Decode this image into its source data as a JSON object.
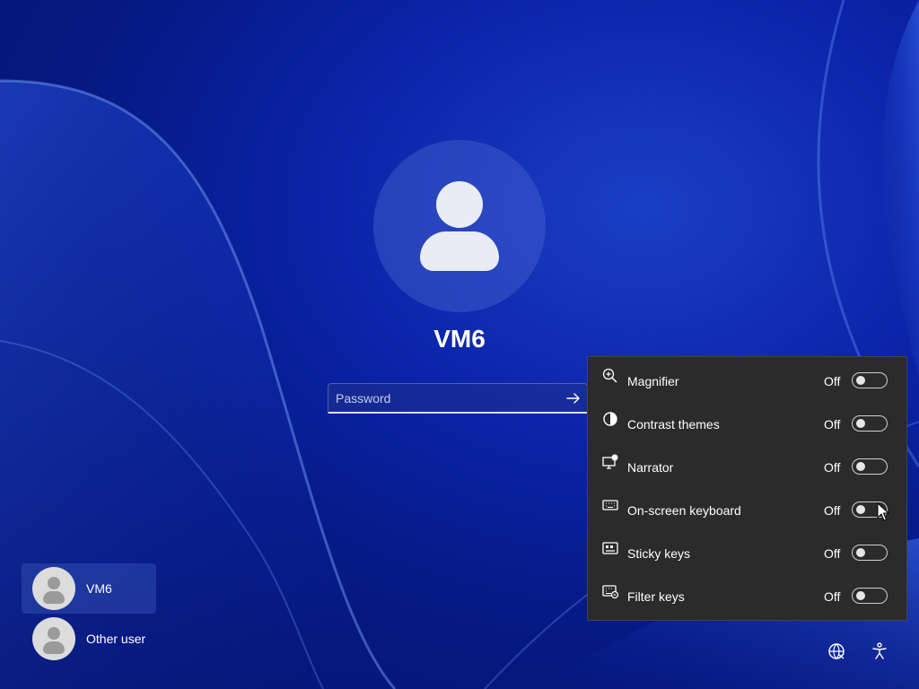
{
  "lock_screen": {
    "username": "VM6",
    "password_placeholder": "Password"
  },
  "user_list": [
    {
      "name": "VM6",
      "active": true
    },
    {
      "name": "Other user",
      "active": false
    }
  ],
  "accessibility_panel": {
    "items": [
      {
        "label": "Magnifier",
        "state": "Off",
        "icon": "magnifier-icon"
      },
      {
        "label": "Contrast themes",
        "state": "Off",
        "icon": "contrast-icon"
      },
      {
        "label": "Narrator",
        "state": "Off",
        "icon": "narrator-icon"
      },
      {
        "label": "On-screen keyboard",
        "state": "Off",
        "icon": "keyboard-icon"
      },
      {
        "label": "Sticky keys",
        "state": "Off",
        "icon": "sticky-keys-icon"
      },
      {
        "label": "Filter keys",
        "state": "Off",
        "icon": "filter-keys-icon"
      }
    ]
  },
  "bottom_bar": {
    "network_icon": "network-icon",
    "accessibility_icon": "accessibility-icon"
  },
  "colors": {
    "background": "#0b23a8",
    "panel": "#2b2b2b",
    "text": "#ffffff"
  }
}
